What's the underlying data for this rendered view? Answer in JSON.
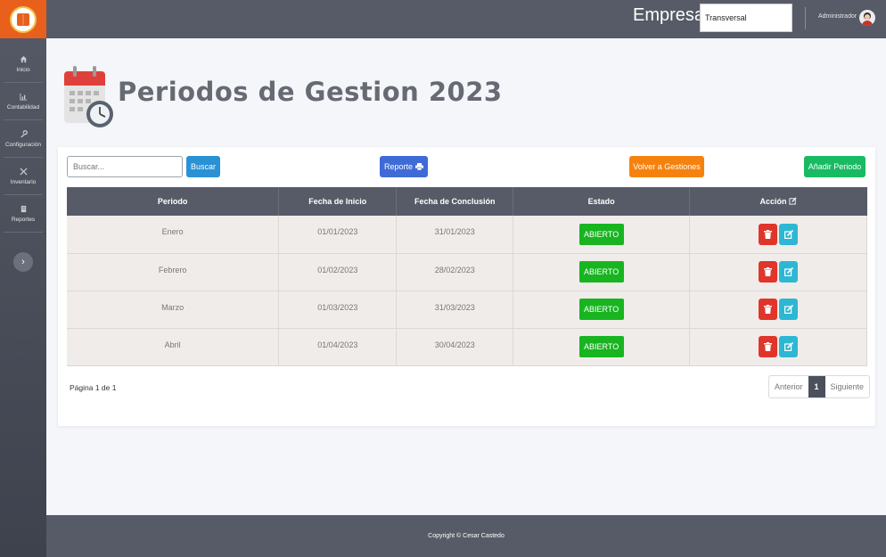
{
  "sidebar": {
    "items": [
      {
        "label": "Inicio",
        "icon": "home-icon"
      },
      {
        "label": "Contabilidad",
        "icon": "chart-icon"
      },
      {
        "label": "Configuración",
        "icon": "wrench-icon"
      },
      {
        "label": "Inventario",
        "icon": "tools-icon"
      },
      {
        "label": "Reportes",
        "icon": "document-icon"
      }
    ]
  },
  "header": {
    "empresa_label": "Empresa:",
    "empresa_value": "Transversal",
    "user_name": "Administrador"
  },
  "page": {
    "title": "Periodos de Gestion 2023"
  },
  "toolbar": {
    "search_placeholder": "Buscar...",
    "buscar": "Buscar",
    "reporte": "Reporte",
    "volver": "Volver a Gestiones",
    "anadir": "Añadir Periodo"
  },
  "table": {
    "columns": [
      "Periodo",
      "Fecha de Inicio",
      "Fecha de Conclusión",
      "Estado",
      "Acción"
    ],
    "rows": [
      {
        "periodo": "Enero",
        "inicio": "01/01/2023",
        "conclusion": "31/01/2023",
        "estado": "ABIERTO"
      },
      {
        "periodo": "Febrero",
        "inicio": "01/02/2023",
        "conclusion": "28/02/2023",
        "estado": "ABIERTO"
      },
      {
        "periodo": "Marzo",
        "inicio": "01/03/2023",
        "conclusion": "31/03/2023",
        "estado": "ABIERTO"
      },
      {
        "periodo": "Abril",
        "inicio": "01/04/2023",
        "conclusion": "30/04/2023",
        "estado": "ABIERTO"
      }
    ]
  },
  "pagination": {
    "info": "Página 1 de 1",
    "prev": "Anterior",
    "current": "1",
    "next": "Siguiente"
  },
  "footer": {
    "copyright": "Copyright © Cesar Castedo"
  },
  "colors": {
    "sidebar": "#4a4e59",
    "header": "#575b67",
    "logo_bg": "#e8601c",
    "buscar": "#2a91d5",
    "reporte": "#3f6bd6",
    "volver": "#f5820e",
    "anadir": "#18ba62",
    "estado": "#18b521",
    "delete": "#e0352a",
    "edit": "#2db7d3"
  }
}
